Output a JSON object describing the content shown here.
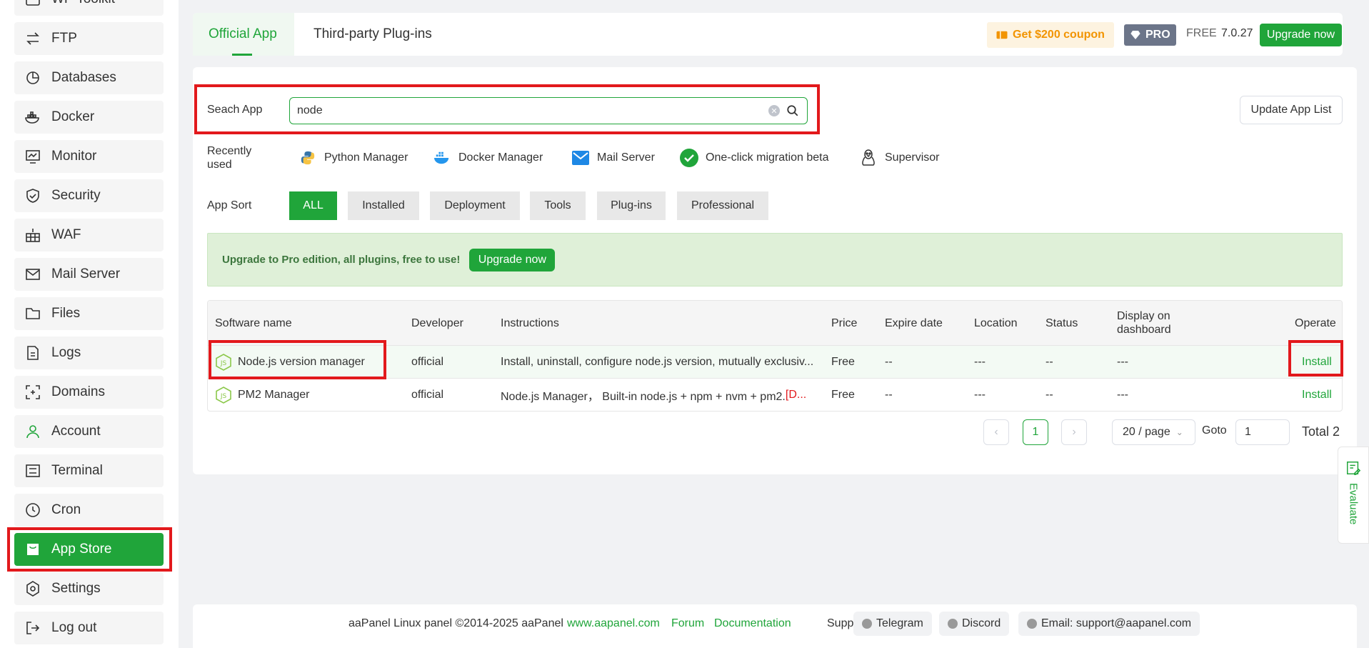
{
  "sidebar": {
    "items": [
      {
        "label": "WP Toolkit",
        "icon": "wp-toolkit-icon"
      },
      {
        "label": "FTP",
        "icon": "ftp-icon"
      },
      {
        "label": "Databases",
        "icon": "databases-icon"
      },
      {
        "label": "Docker",
        "icon": "docker-icon"
      },
      {
        "label": "Monitor",
        "icon": "monitor-icon"
      },
      {
        "label": "Security",
        "icon": "shield-icon"
      },
      {
        "label": "WAF",
        "icon": "waf-icon"
      },
      {
        "label": "Mail Server",
        "icon": "mail-icon"
      },
      {
        "label": "Files",
        "icon": "folder-icon"
      },
      {
        "label": "Logs",
        "icon": "logs-icon"
      },
      {
        "label": "Domains",
        "icon": "domains-icon"
      },
      {
        "label": "Account",
        "icon": "user-icon"
      },
      {
        "label": "Terminal",
        "icon": "terminal-icon"
      },
      {
        "label": "Cron",
        "icon": "clock-icon"
      },
      {
        "label": "App Store",
        "icon": "store-icon"
      },
      {
        "label": "Settings",
        "icon": "gear-icon"
      },
      {
        "label": "Log out",
        "icon": "logout-icon"
      }
    ],
    "active": "App Store"
  },
  "header": {
    "tabs": [
      {
        "label": "Official App",
        "active": true
      },
      {
        "label": "Third-party Plug-ins",
        "active": false
      }
    ],
    "coupon": "Get $200 coupon",
    "pro_label": "PRO",
    "free_label": "FREE",
    "version": "7.0.27",
    "upgrade_label": "Upgrade now"
  },
  "search": {
    "label": "Seach App",
    "value": "node",
    "update_button": "Update App List"
  },
  "recent": {
    "label": "Recently used",
    "items": [
      {
        "label": "Python Manager",
        "icon": "python-icon"
      },
      {
        "label": "Docker Manager",
        "icon": "docker-icon"
      },
      {
        "label": "Mail Server",
        "icon": "mail-icon"
      },
      {
        "label": "One-click migration beta",
        "icon": "check-circle-icon"
      },
      {
        "label": "Supervisor",
        "icon": "penguin-icon"
      }
    ]
  },
  "sort": {
    "label": "App Sort",
    "options": [
      "ALL",
      "Installed",
      "Deployment",
      "Tools",
      "Plug-ins",
      "Professional"
    ],
    "active": "ALL"
  },
  "promo": {
    "text": "Upgrade to Pro edition, all plugins, free to use!",
    "button": "Upgrade now"
  },
  "table": {
    "headers": {
      "name": "Software name",
      "developer": "Developer",
      "instructions": "Instructions",
      "price": "Price",
      "expire": "Expire date",
      "location": "Location",
      "status": "Status",
      "display": "Display on dashboard",
      "operate": "Operate"
    },
    "rows": [
      {
        "name": "Node.js version manager",
        "developer": "official",
        "instructions": "Install, uninstall, configure node.js version, mutually exclusiv...",
        "instructions_note": "",
        "price": "Free",
        "expire": "--",
        "location": "---",
        "status": "--",
        "display": "---",
        "operate": "Install"
      },
      {
        "name": "PM2 Manager",
        "developer": "official",
        "instructions": "Node.js Manager， Built-in node.js + npm + nvm + pm2. ",
        "instructions_note": "[D...",
        "price": "Free",
        "expire": "--",
        "location": "---",
        "status": "--",
        "display": "---",
        "operate": "Install"
      }
    ]
  },
  "pagination": {
    "current": "1",
    "page_size": "20 / page",
    "goto_label": "Goto",
    "goto_value": "1",
    "total": "Total 2"
  },
  "footer": {
    "copyright": "aaPanel Linux panel ©2014-2025 aaPanel",
    "site": "www.aapanel.com",
    "forum": "Forum",
    "docs": "Documentation",
    "support_label": "Support:",
    "telegram": "Telegram",
    "discord": "Discord",
    "email": "Email: support@aapanel.com"
  },
  "evaluate": "Evaluate",
  "colors": {
    "accent": "#20a53a",
    "highlight": "#e2191c",
    "coupon": "#f29400"
  }
}
